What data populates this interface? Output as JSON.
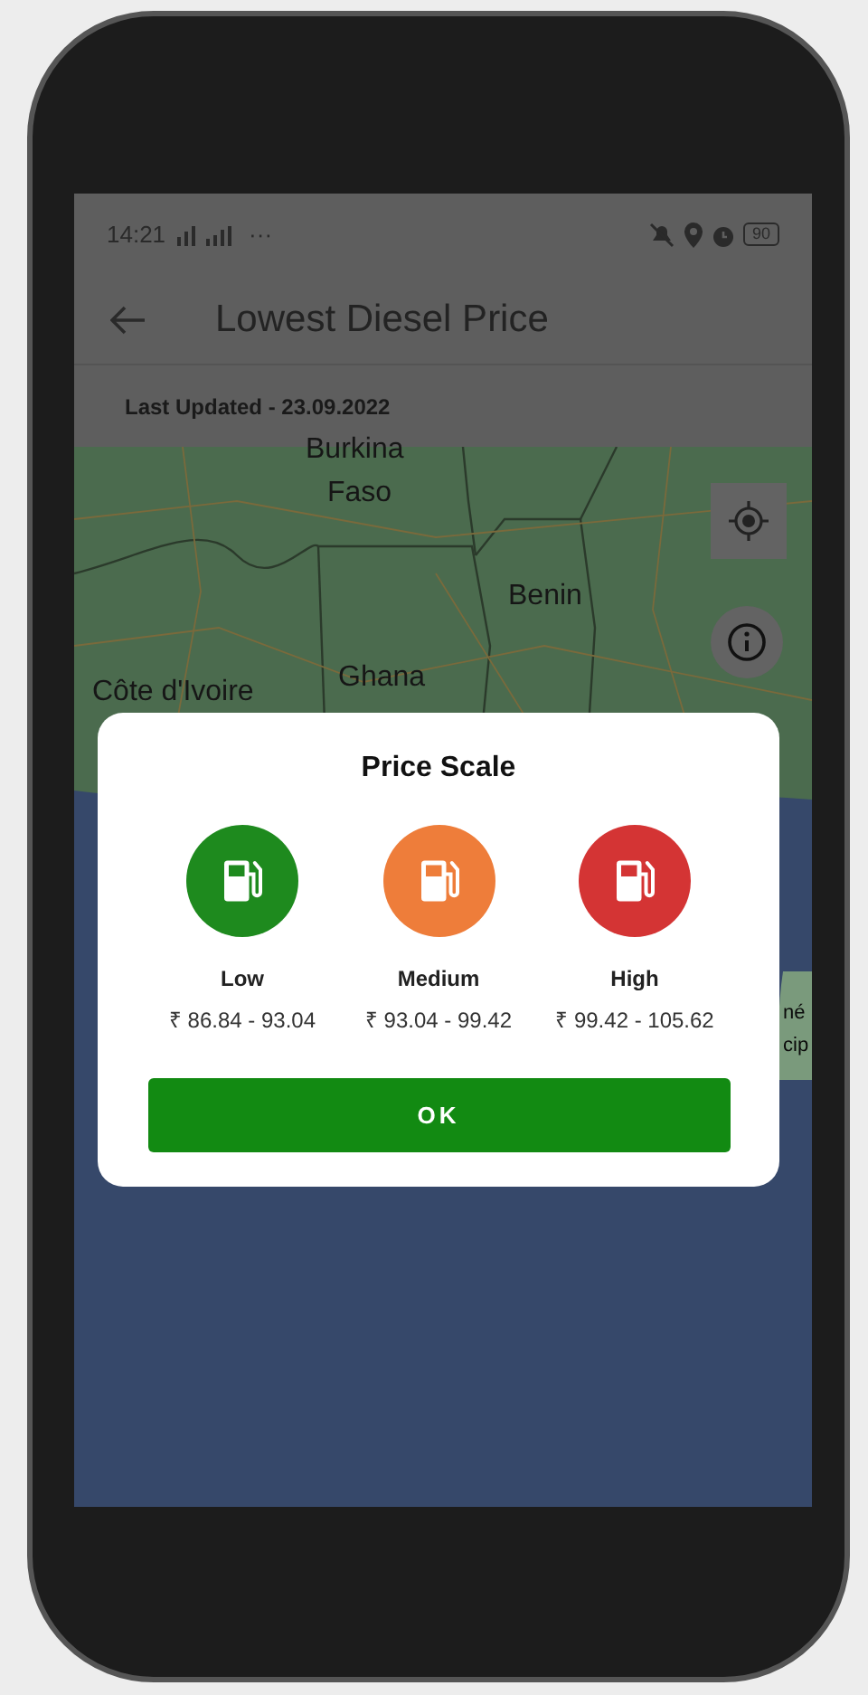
{
  "status_bar": {
    "time": "14:21",
    "more": "···",
    "battery": "90"
  },
  "app_bar": {
    "title": "Lowest Diesel Price"
  },
  "last_updated": "Last Updated - 23.09.2022",
  "map": {
    "labels": [
      {
        "text": "Burkina",
        "kind": "country"
      },
      {
        "text": "Faso",
        "kind": "country"
      },
      {
        "text": "Benin",
        "kind": "country"
      },
      {
        "text": "Ghana",
        "kind": "country"
      },
      {
        "text": "Côte d'Ivoire",
        "kind": "country"
      },
      {
        "text": "né",
        "kind": "edge"
      },
      {
        "text": "cip",
        "kind": "edge"
      }
    ]
  },
  "dialog": {
    "title": "Price Scale",
    "levels": [
      {
        "label": "Low",
        "range": "₹ 86.84 - 93.04",
        "color": "#1e8a1e"
      },
      {
        "label": "Medium",
        "range": "₹ 93.04 - 99.42",
        "color": "#ee7d3a"
      },
      {
        "label": "High",
        "range": "₹ 99.42 - 105.62",
        "color": "#d43434"
      }
    ],
    "button": "OK"
  }
}
